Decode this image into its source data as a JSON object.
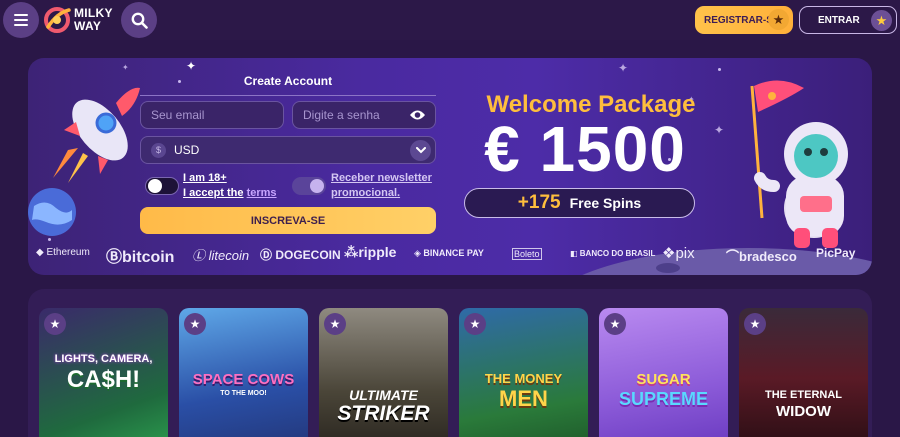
{
  "header": {
    "logo_line1": "MILKY",
    "logo_line2": "WAY",
    "register_label": "REGISTRAR-SE",
    "enter_label": "ENTRAR"
  },
  "form": {
    "title": "Create Account",
    "email_placeholder": "Seu email",
    "password_placeholder": "Digite a senha",
    "currency": "USD",
    "currency_symbol": "$",
    "age_label": "I am 18+",
    "accept_prefix": "I accept the",
    "terms_label": "terms",
    "newsletter_line1": "Receber newsletter",
    "newsletter_line2": "promocional.",
    "submit_label": "INSCREVA-SE"
  },
  "promo": {
    "welcome": "Welcome Package",
    "amount": "€ 1500",
    "spins_count": "+175",
    "spins_label": "Free Spins"
  },
  "payments": [
    "Ethereum",
    "bitcoin",
    "litecoin",
    "DOGECOIN",
    "ripple",
    "BINANCE PAY",
    "Boleto",
    "BANCO DO BRASIL",
    "pix",
    "bradesco",
    "PicPay"
  ],
  "games": [
    {
      "line1": "LIGHTS, CAMERA,",
      "line2": "CA$H!"
    },
    {
      "line1": "SPACE COWS",
      "line2": "TO THE MOO!"
    },
    {
      "line1": "ULTIMATE",
      "line2": "STRIKER"
    },
    {
      "line1": "THE MONEY",
      "line2": "MEN"
    },
    {
      "line1": "SUGAR",
      "line2": "SUPREME"
    },
    {
      "line1": "THE ETERNAL",
      "line2": "WIDOW"
    }
  ],
  "colors": {
    "background": "#2a1747",
    "accent_gold": "#ffbe3d",
    "banner": "#4a2aa0"
  }
}
